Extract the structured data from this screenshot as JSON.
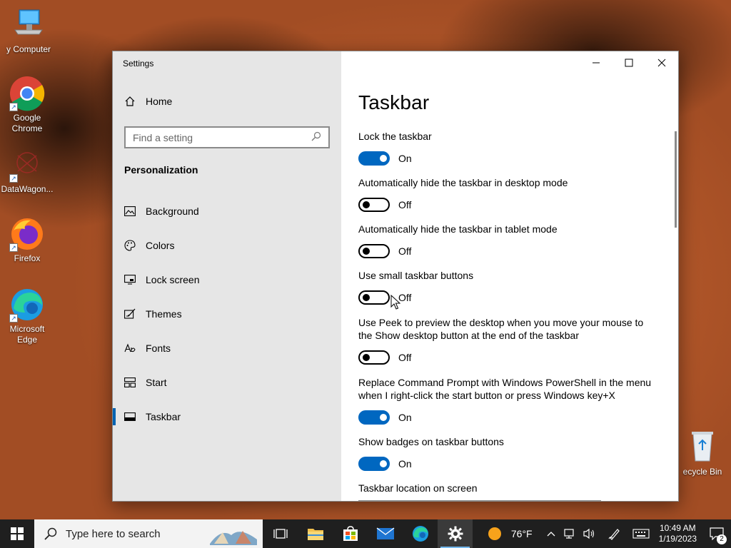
{
  "desktop": {
    "icons": [
      {
        "label": "y Computer"
      },
      {
        "label": "Google Chrome"
      },
      {
        "label": "DataWagon..."
      },
      {
        "label": "Firefox"
      },
      {
        "label": "Microsoft Edge"
      },
      {
        "label": "ecycle Bin"
      }
    ]
  },
  "window": {
    "title": "Settings",
    "controls": {
      "minimize": "minimize-icon",
      "maximize": "maximize-icon",
      "close": "close-icon"
    }
  },
  "sidebar": {
    "home_label": "Home",
    "search_placeholder": "Find a setting",
    "section_title": "Personalization",
    "items": [
      {
        "label": "Background",
        "icon": "image-icon"
      },
      {
        "label": "Colors",
        "icon": "palette-icon"
      },
      {
        "label": "Lock screen",
        "icon": "monitor-icon"
      },
      {
        "label": "Themes",
        "icon": "brush-icon"
      },
      {
        "label": "Fonts",
        "icon": "font-icon"
      },
      {
        "label": "Start",
        "icon": "start-grid-icon"
      },
      {
        "label": "Taskbar",
        "icon": "taskbar-icon",
        "active": true
      }
    ]
  },
  "content": {
    "page_title": "Taskbar",
    "settings": [
      {
        "label": "Lock the taskbar",
        "state": "On"
      },
      {
        "label": "Automatically hide the taskbar in desktop mode",
        "state": "Off"
      },
      {
        "label": "Automatically hide the taskbar in tablet mode",
        "state": "Off"
      },
      {
        "label": "Use small taskbar buttons",
        "state": "Off"
      },
      {
        "label": "Use Peek to preview the desktop when you move your mouse to the Show desktop button at the end of the taskbar",
        "state": "Off"
      },
      {
        "label": "Replace Command Prompt with Windows PowerShell in the menu when I right-click the start button or press Windows key+X",
        "state": "On"
      },
      {
        "label": "Show badges on taskbar buttons",
        "state": "On"
      }
    ],
    "location_label": "Taskbar location on screen"
  },
  "taskbar": {
    "search_placeholder": "Type here to search",
    "weather": "76°F",
    "time": "10:49 AM",
    "date": "1/19/2023",
    "notification_count": "2"
  },
  "colors": {
    "accent": "#0067c0",
    "active_marker": "#0063b1"
  }
}
